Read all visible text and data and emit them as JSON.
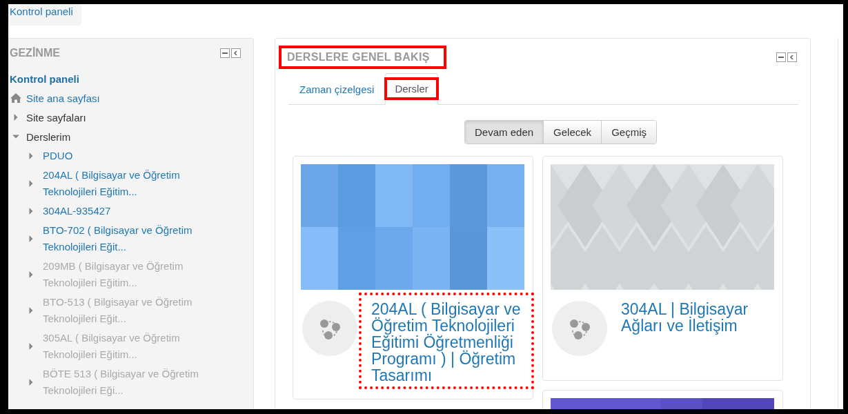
{
  "breadcrumb": {
    "label": "Kontrol paneli"
  },
  "sidebar": {
    "title": "GEZİNME",
    "items": [
      {
        "kind": "heading",
        "label": "Kontrol paneli"
      },
      {
        "kind": "home",
        "label": "Site ana sayfası"
      },
      {
        "kind": "branch",
        "label": "Site sayfaları",
        "expanded": false
      },
      {
        "kind": "branch",
        "label": "Derslerim",
        "expanded": true,
        "children": [
          {
            "label": "PDUO",
            "dimmed": false
          },
          {
            "label": "204AL ( Bilgisayar ve Öğretim Teknolojileri Eğitim...",
            "dimmed": false
          },
          {
            "label": "304AL-935427",
            "dimmed": false
          },
          {
            "label": "BTO-702 ( Bilgisayar ve Öğretim Teknolojileri Eğit...",
            "dimmed": false
          },
          {
            "label": "209MB ( Bilgisayar ve Öğretim Teknolojileri Eğitim...",
            "dimmed": true
          },
          {
            "label": "BTO-513 ( Bilgisayar ve Öğretim Teknolojileri Eğit...",
            "dimmed": true
          },
          {
            "label": "305AL ( Bilgisayar ve Öğretim Teknolojileri Eğitim...",
            "dimmed": true
          },
          {
            "label": "BÖTE 513 ( Bilgisayar ve Öğretim Teknolojileri Eği...",
            "dimmed": true
          }
        ]
      }
    ]
  },
  "overview": {
    "title": "DERSLERE GENEL BAKIŞ",
    "highlighted": true,
    "tabs": [
      {
        "label": "Zaman çizelgesi",
        "selected": false
      },
      {
        "label": "Dersler",
        "selected": true,
        "highlighted": true
      }
    ],
    "filters": [
      {
        "label": "Devam eden",
        "selected": true
      },
      {
        "label": "Gelecek",
        "selected": false
      },
      {
        "label": "Geçmiş",
        "selected": false
      }
    ],
    "courses": [
      {
        "title": "204AL ( Bilgisayar ve Öğretim Teknolojileri Eğitimi Öğretmenliği Programı ) | Öğretim Tasarımı",
        "image": {
          "kind": "squares"
        },
        "highlighted": true
      },
      {
        "title": "304AL | Bilgisayar Ağları ve İletişim",
        "image": {
          "kind": "diamonds"
        },
        "highlighted": false
      },
      {
        "image": {
          "kind": "plain"
        }
      }
    ]
  }
}
